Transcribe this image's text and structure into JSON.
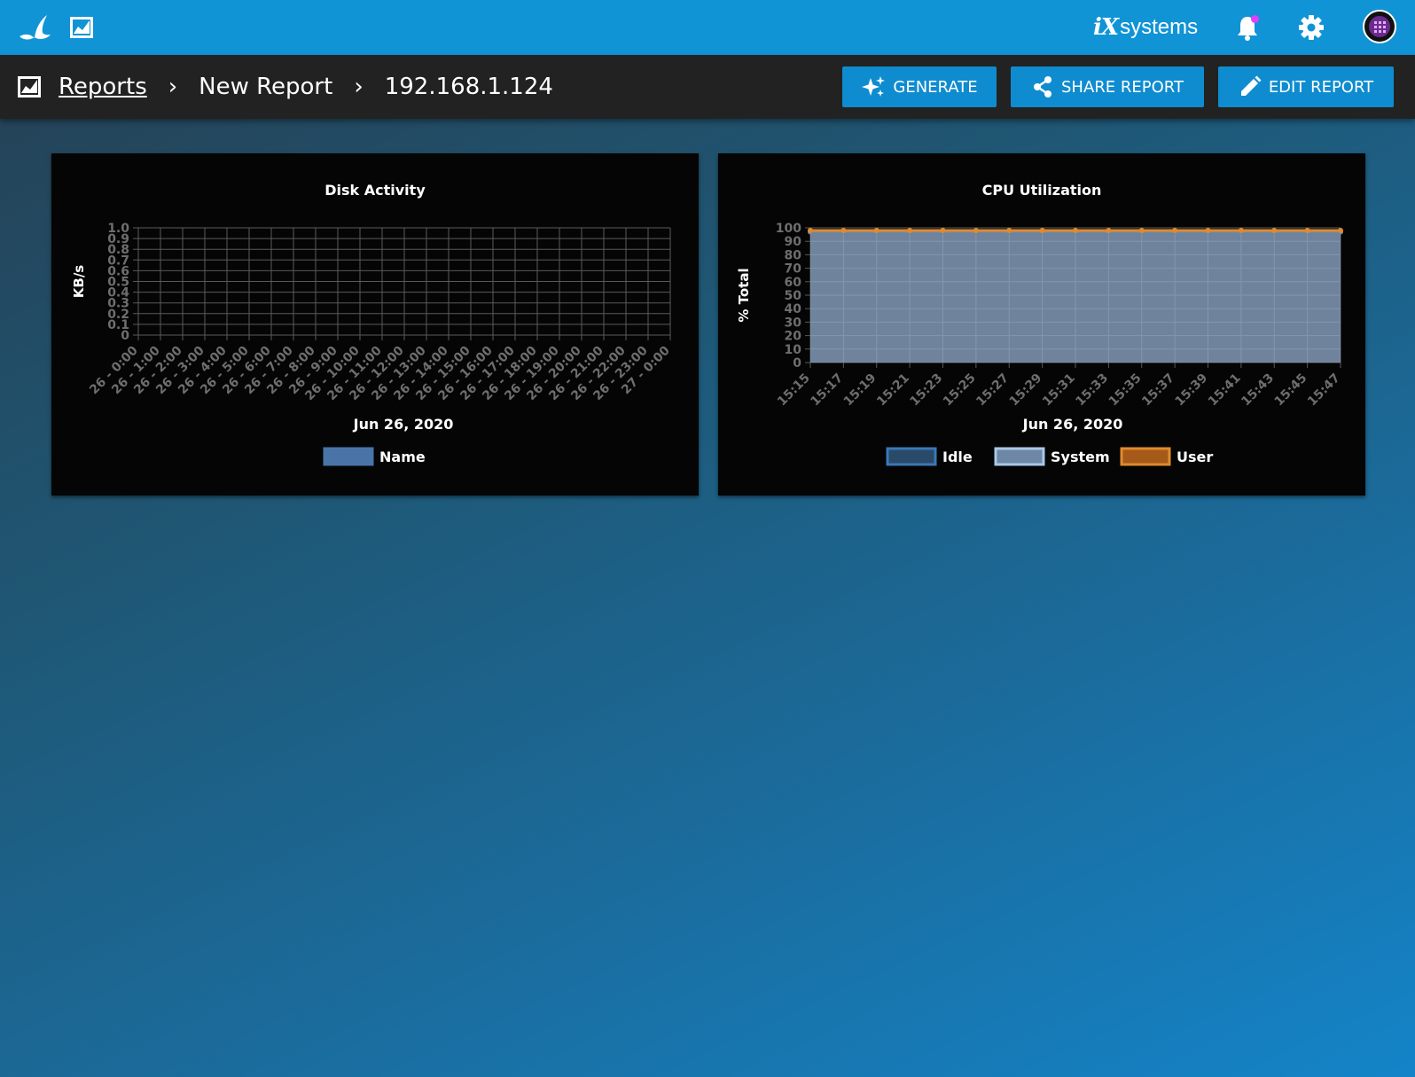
{
  "topbar": {
    "logo_icon": "truenas-logo-icon",
    "reports_icon": "chart-line-icon",
    "brand_ix": "iX",
    "brand_systems": "systems",
    "bell_icon": "bell-icon",
    "settings_icon": "gear-icon",
    "avatar_icon": "power-avatar-icon"
  },
  "breadcrumb": {
    "icon": "chart-line-icon",
    "items": [
      "Reports",
      "New Report",
      "192.168.1.124"
    ],
    "separator": "›"
  },
  "actions": {
    "generate": "GENERATE",
    "share": "SHARE REPORT",
    "edit": "EDIT REPORT"
  },
  "colors": {
    "topbar": "#1194d6",
    "button": "#0f8cd0",
    "idle": "#2a4a6a",
    "system": "#6f87a6",
    "user": "#e08a2e",
    "disk_series": "#4a74a8"
  },
  "chart_data": [
    {
      "type": "line",
      "title": "Disk Activity",
      "xlabel": "Jun 26, 2020",
      "ylabel": "KB/s",
      "yticks": [
        "0",
        "0.1",
        "0.2",
        "0.3",
        "0.4",
        "0.5",
        "0.6",
        "0.7",
        "0.8",
        "0.9",
        "1.0"
      ],
      "ylim": [
        0,
        1.0
      ],
      "categories": [
        "26 - 0:00",
        "26 - 1:00",
        "26 - 2:00",
        "26 - 3:00",
        "26 - 4:00",
        "26 - 5:00",
        "26 - 6:00",
        "26 - 7:00",
        "26 - 8:00",
        "26 - 9:00",
        "26 - 10:00",
        "26 - 11:00",
        "26 - 12:00",
        "26 - 13:00",
        "26 - 14:00",
        "26 - 15:00",
        "26 - 16:00",
        "26 - 17:00",
        "26 - 18:00",
        "26 - 19:00",
        "26 - 20:00",
        "26 - 21:00",
        "26 - 22:00",
        "26 - 23:00",
        "27 - 0:00"
      ],
      "series": [
        {
          "name": "Name",
          "values": []
        }
      ],
      "grid": true,
      "legend": "bottom"
    },
    {
      "type": "area",
      "title": "CPU Utilization",
      "xlabel": "Jun 26, 2020",
      "ylabel": "% Total",
      "yticks": [
        "0",
        "10",
        "20",
        "30",
        "40",
        "50",
        "60",
        "70",
        "80",
        "90",
        "100"
      ],
      "ylim": [
        0,
        100
      ],
      "categories": [
        "15:15",
        "15:17",
        "15:19",
        "15:21",
        "15:23",
        "15:25",
        "15:27",
        "15:29",
        "15:31",
        "15:33",
        "15:35",
        "15:37",
        "15:39",
        "15:41",
        "15:43",
        "15:45",
        "15:47"
      ],
      "series": [
        {
          "name": "Idle",
          "values": [
            97,
            97,
            97,
            97,
            97,
            97,
            97,
            97,
            97,
            97,
            97,
            97,
            97,
            97,
            97,
            97,
            97
          ]
        },
        {
          "name": "System",
          "values": [
            97,
            97,
            97,
            97,
            97,
            97,
            97,
            97,
            97,
            97,
            97,
            97,
            97,
            97,
            97,
            97,
            97
          ]
        },
        {
          "name": "User",
          "values": [
            98,
            98,
            98,
            98,
            98,
            98,
            98,
            98,
            98,
            98,
            98,
            98,
            98,
            98,
            98,
            98,
            98
          ]
        }
      ],
      "grid": true,
      "legend": "bottom"
    }
  ]
}
